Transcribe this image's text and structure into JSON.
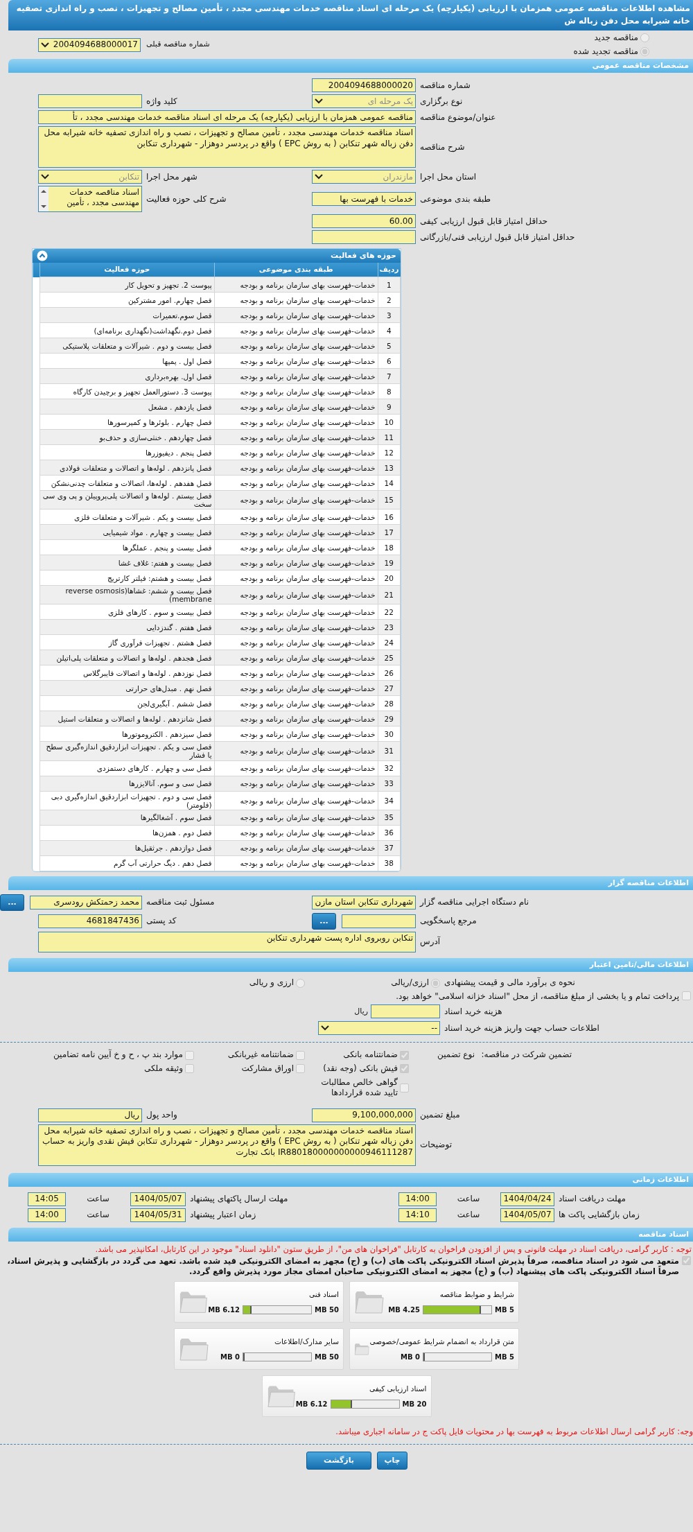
{
  "window": {
    "title": "مشاهده اطلاعات مناقصه عمومی همزمان با ارزیابی (یکپارچه) یک مرحله ای اسناد مناقصه خدمات مهندسی مجدد ، تأمین مصالح و تجهیزات ، نصب و راه اندازی تصفیه خانه شیرابه محل دفن زباله ش"
  },
  "tender_status": [
    {
      "label": "مناقصه جدید",
      "selected": false
    },
    {
      "label": "مناقصه تجدید شده",
      "selected": true
    }
  ],
  "previous_tender": {
    "label": "شماره مناقصه قبلی",
    "value": "2004094688000017"
  },
  "general": {
    "title": "مشخصات مناقصه عمومی",
    "rows": [
      [
        {
          "kind": "text",
          "label": "شماره مناقصه",
          "value": "2004094688000020"
        }
      ],
      [
        {
          "kind": "select",
          "label": "نوع برگزاری",
          "value": "یک مرحله ای",
          "disabled": true
        },
        {
          "kind": "text",
          "label": "کلید واژه"
        }
      ],
      [
        {
          "kind": "wide",
          "label": "عنوان/موضوع مناقصه",
          "value": "مناقصه عمومی همزمان با ارزیابی (یکپارچه) یک مرحله ای اسناد مناقصه خدمات مهندسی مجدد ، تأ"
        }
      ],
      [
        {
          "kind": "textarea",
          "label": "شرح مناقصه",
          "value": "اسناد مناقصه خدمات مهندسی مجدد ، تأمین مصالح و تجهیزات ، نصب و راه اندازی تصفیه خانه شیرابه محل دفن زباله شهر تنکابن ( به روش  EPC ) واقع در پردسر دوهزار - شهرداری تنکابن"
        }
      ],
      [
        {
          "kind": "select",
          "label": "استان محل اجرا",
          "value": "مازندران",
          "disabled": true
        },
        {
          "kind": "select",
          "label": "شهر محل اجرا",
          "value": "تنکابن",
          "disabled": true
        }
      ],
      [
        {
          "kind": "text",
          "label": "طبقه بندی موضوعی",
          "value": "خدمات با فهرست بها"
        },
        {
          "kind": "list",
          "label": "شرح کلی حوزه فعالیت",
          "value": "اسناد مناقصه خدمات مهندسی مجدد ، تأمین"
        }
      ],
      [
        {
          "kind": "text",
          "label": "حداقل امتیاز قابل قبول ارزیابی کیفی",
          "value": "60.00"
        }
      ],
      [
        {
          "kind": "text",
          "label": "حداقل امتیاز قابل قبول ارزیابی فنی/بازرگانی"
        }
      ]
    ]
  },
  "activities": {
    "title": "حوزه های فعالیت",
    "columns": [
      "ردیف",
      "طبقه بندی موضوعی",
      "حوزه فعالیت"
    ],
    "rows": [
      {
        "number": "1",
        "category": "خدمات-فهرست بهای سازمان برنامه و بودجه",
        "activity": "پیوست 2. تجهیز و تحویل کار"
      },
      {
        "number": "2",
        "category": "خدمات-فهرست بهای سازمان برنامه و بودجه",
        "activity": "فصل چهارم. امور مشترکین"
      },
      {
        "number": "3",
        "category": "خدمات-فهرست بهای سازمان برنامه و بودجه",
        "activity": "فصل سوم.تعمیرات"
      },
      {
        "number": "4",
        "category": "خدمات-فهرست بهای سازمان برنامه و بودجه",
        "activity": "فصل دوم.نگهداشت(نگهداری برنامه‌ای)"
      },
      {
        "number": "5",
        "category": "خدمات-فهرست بهای سازمان برنامه و بودجه",
        "activity": "فصل بیست و دوم . شیرآلات و متعلقات پلاستیکی"
      },
      {
        "number": "6",
        "category": "خدمات-فهرست بهای سازمان برنامه و بودجه",
        "activity": "فصل اول . پمپها"
      },
      {
        "number": "7",
        "category": "خدمات-فهرست بهای سازمان برنامه و بودجه",
        "activity": "فصل اول. بهره‌برداری"
      },
      {
        "number": "8",
        "category": "خدمات-فهرست بهای سازمان برنامه و بودجه",
        "activity": "پیوست 3. دستورالعمل تجهیز و برچیدن کارگاه"
      },
      {
        "number": "9",
        "category": "خدمات-فهرست بهای سازمان برنامه و بودجه",
        "activity": "فصل یازدهم . مشعل"
      },
      {
        "number": "10",
        "category": "خدمات-فهرست بهای سازمان برنامه و بودجه",
        "activity": "فصل چهارم . بلوئرها و کمپرسورها"
      },
      {
        "number": "11",
        "category": "خدمات-فهرست بهای سازمان برنامه و بودجه",
        "activity": "فصل چهاردهم . خنثی‌سازی و حذف‌بو"
      },
      {
        "number": "12",
        "category": "خدمات-فهرست بهای سازمان برنامه و بودجه",
        "activity": "فصل پنجم . دیفیوزرها"
      },
      {
        "number": "13",
        "category": "خدمات-فهرست بهای سازمان برنامه و بودجه",
        "activity": "فصل پانزدهم . لوله‌ها و اتصالات و متعلقات فولادی"
      },
      {
        "number": "14",
        "category": "خدمات-فهرست بهای سازمان برنامه و بودجه",
        "activity": "فصل هفدهم . لوله‌ها، اتصالات و متعلقات چدنی‌نشکن"
      },
      {
        "number": "15",
        "category": "خدمات-فهرست بهای سازمان برنامه و بودجه",
        "activity": "فصل بیستم . لوله‌ها و اتصالات پلی‌پروپیلن و پی وی سی سخت"
      },
      {
        "number": "16",
        "category": "خدمات-فهرست بهای سازمان برنامه و بودجه",
        "activity": "فصل بیست و یکم . شیرآلات و متعلقات فلزی"
      },
      {
        "number": "17",
        "category": "خدمات-فهرست بهای سازمان برنامه و بودجه",
        "activity": "فصل بیست و چهارم . مواد شیمیایی"
      },
      {
        "number": "18",
        "category": "خدمات-فهرست بهای سازمان برنامه و بودجه",
        "activity": "فصل بیست و پنجم . عملگرها"
      },
      {
        "number": "19",
        "category": "خدمات-فهرست بهای سازمان برنامه و بودجه",
        "activity": "فصل بیست و هفتم: غلاف غشا"
      },
      {
        "number": "20",
        "category": "خدمات-فهرست بهای سازمان برنامه و بودجه",
        "activity": "فصل بیست و هشتم: فیلتر کارتریج"
      },
      {
        "number": "21",
        "category": "خدمات-فهرست بهای سازمان برنامه و بودجه",
        "activity": "فصل بیست و ششم: غشاها(reverse osmosis membrane)"
      },
      {
        "number": "22",
        "category": "خدمات-فهرست بهای سازمان برنامه و بودجه",
        "activity": "فصل بیست و سوم . کارهای فلزی"
      },
      {
        "number": "23",
        "category": "خدمات-فهرست بهای سازمان برنامه و بودجه",
        "activity": "فصل هفتم . گندزدایی"
      },
      {
        "number": "24",
        "category": "خدمات-فهرست بهای سازمان برنامه و بودجه",
        "activity": "فصل هشتم . تجهیزات فرآوری گاز"
      },
      {
        "number": "25",
        "category": "خدمات-فهرست بهای سازمان برنامه و بودجه",
        "activity": "فصل هجدهم . لوله‌ها و اتصالات و متعلقات  پلی‌اتیلن"
      },
      {
        "number": "26",
        "category": "خدمات-فهرست بهای سازمان برنامه و بودجه",
        "activity": "فصل نوزدهم . لوله‌ها و اتصالات فایبرگلاس"
      },
      {
        "number": "27",
        "category": "خدمات-فهرست بهای سازمان برنامه و بودجه",
        "activity": "فصل نهم . مبدل‌های حرارتی"
      },
      {
        "number": "28",
        "category": "خدمات-فهرست بهای سازمان برنامه و بودجه",
        "activity": "فصل ششم . آبگیری‌لجن"
      },
      {
        "number": "29",
        "category": "خدمات-فهرست بهای سازمان برنامه و بودجه",
        "activity": "فصل شانزدهم . لوله‌ها و اتصالات و متعلقات استیل"
      },
      {
        "number": "30",
        "category": "خدمات-فهرست بهای سازمان برنامه و بودجه",
        "activity": "فصل سیزدهم . الکتروموتورها"
      },
      {
        "number": "31",
        "category": "خدمات-فهرست بهای سازمان برنامه و بودجه",
        "activity": "فصل سی و یکم . تجهیزات ابزاردقیق اندازه‌گیری سطح یا فشار"
      },
      {
        "number": "32",
        "category": "خدمات-فهرست بهای سازمان برنامه و بودجه",
        "activity": "فصل سی و چهارم . کارهای دستمزدی"
      },
      {
        "number": "33",
        "category": "خدمات-فهرست بهای سازمان برنامه و بودجه",
        "activity": "فصل سی و سوم. آنالایزرها"
      },
      {
        "number": "34",
        "category": "خدمات-فهرست بهای سازمان برنامه و بودجه",
        "activity": "فصل سی و دوم . تجهیزات ابزاردقیق اندازه‌گیری دبی (فلومتر)"
      },
      {
        "number": "35",
        "category": "خدمات-فهرست بهای سازمان برنامه و بودجه",
        "activity": "فصل سوم . آشغالگیرها"
      },
      {
        "number": "36",
        "category": "خدمات-فهرست بهای سازمان برنامه و بودجه",
        "activity": "فصل دوم . همزن‌ها"
      },
      {
        "number": "37",
        "category": "خدمات-فهرست بهای سازمان برنامه و بودجه",
        "activity": "فصل دوازدهم . جرثقیل‌ها"
      },
      {
        "number": "38",
        "category": "خدمات-فهرست بهای سازمان برنامه و بودجه",
        "activity": "فصل دهم . دیگ حرارتی آب گرم"
      }
    ]
  },
  "organizer": {
    "title": "اطلاعات مناقصه گزار",
    "rows": [
      [
        {
          "kind": "text",
          "label": "نام دستگاه اجرایی مناقصه گزار",
          "value": "شهرداری تنکابن استان مازن"
        },
        {
          "kind": "text",
          "label": "مسئول ثبت مناقصه",
          "value": "محمد  زحمتکش رودسری",
          "button": "..."
        }
      ],
      [
        {
          "kind": "text",
          "label": "مرجع پاسخگویی",
          "button": "..."
        },
        {
          "kind": "text",
          "label": "کد پستی",
          "value": "4681847436"
        }
      ],
      [
        {
          "kind": "textarea",
          "label": "آدرس",
          "value": "تنکابن روبروی اداره پست شهرداری تنکابن"
        }
      ]
    ]
  },
  "finance": {
    "title": "اطلاعات مالی/تامین اعتبار",
    "estimate": {
      "label": "نحوه ی برآورد مالی و قیمت پیشنهادی",
      "options": [
        {
          "label": "ارزی/ریالی",
          "selected": true
        },
        {
          "label": "ارزی و ریالی",
          "selected": false
        }
      ]
    },
    "treasury": {
      "label": "پرداخت تمام و یا بخشی از مبلغ مناقصه، از محل \"اسناد خزانه اسلامی\" خواهد بود.",
      "checked": false
    },
    "document_fee": {
      "label": "هزینه خرید اسناد",
      "unit": "ریال"
    },
    "fee_account": {
      "label": "اطلاعات حساب جهت واریز هزینه خرید اسناد",
      "value": "--"
    },
    "guarantee": {
      "label": "تضمین شرکت در مناقصه:",
      "type_label": "نوع تضمین",
      "options": [
        {
          "label": "ضمانتنامه بانکی",
          "checked": true
        },
        {
          "label": "ضمانتنامه غیربانکی",
          "checked": false
        },
        {
          "label": "موارد بند پ ، ح و خ آیین نامه تضامین",
          "checked": false
        },
        {
          "label": "فیش بانکی (وجه نقد)",
          "checked": true
        },
        {
          "label": "اوراق مشارکت",
          "checked": false
        },
        {
          "label": "وثیقه ملکی",
          "checked": false
        },
        {
          "label": "گواهی خالص مطالبات تایید شده قراردادها",
          "checked": false
        }
      ]
    },
    "rows": [
      [
        {
          "kind": "text",
          "label": "مبلغ تضمین",
          "value": "9,100,000,000"
        },
        {
          "kind": "text",
          "label": "واحد پول",
          "value": "ریال"
        }
      ],
      [
        {
          "kind": "textarea",
          "label": "توضیحات",
          "value": "اسناد مناقصه خدمات مهندسی مجدد ، تأمین مصالح و تجهیزات ، نصب و راه اندازی تصفیه خانه شیرابه محل دفن زباله شهر تنکابن ( به روش  EPC ) واقع در پردسر دوهزار - شهرداری تنکابن  فیش نقدی واریز به حساب IR880180000000000946111287  بانک تجارت"
        }
      ]
    ]
  },
  "schedule": {
    "title": "اطلاعات زمانی",
    "items": [
      {
        "label": "مهلت دریافت اسناد",
        "date": "1404/04/24",
        "time_label": "ساعت",
        "time": "14:00"
      },
      {
        "label": "مهلت ارسال پاکتهای پیشنهاد",
        "date": "1404/05/07",
        "time_label": "ساعت",
        "time": "14:05"
      },
      {
        "label": "زمان بازگشایی پاکت ها",
        "date": "1404/05/07",
        "time_label": "ساعت",
        "time": "14:10"
      },
      {
        "label": "زمان اعتبار پیشنهاد",
        "date": "1404/05/31",
        "time_label": "ساعت",
        "time": "14:00"
      }
    ]
  },
  "documents": {
    "title": "اسناد مناقصه",
    "notice": "توجه : کاربر گرامی، دریافت اسناد در مهلت قانونی و پس از افزودن فراخوان به کارتابل \"فراخوان های من\"، از طریق ستون \"دانلود اسناد\" موجود در این کارتابل، امکانپذیر می باشد.",
    "commitment": {
      "checked": true,
      "label": "متعهد می شود در اسناد مناقصه، صرفاً پذیرش اسناد الکترونیکی پاکت های (ب) و (ج) مجهز به امضای الکترونیکی قید شده باشد. تعهد می گردد در بازگشایی و پذیرش اسناد، صرفاً اسناد الکترونیکی پاکت های پیشنهاد (ب) و (ج) مجهز به امضای الکترونیکی صاحبان امضای مجاز مورد پذیرش واقع گردد."
    },
    "files": [
      {
        "title": "شرایط و ضوابط مناقصه",
        "used": "4.25 MB",
        "max": "5 MB",
        "level": 0.85
      },
      {
        "title": "اسناد فنی",
        "used": "6.12 MB",
        "max": "50 MB",
        "level": 0.12
      },
      {
        "title": "متن قرارداد به انضمام شرایط عمومی/خصوصی",
        "used": "0 MB",
        "max": "5 MB",
        "level": 0
      },
      {
        "title": "سایر مدارک/اطلاعات",
        "used": "0 MB",
        "max": "50 MB",
        "level": 0
      },
      {
        "title": "اسناد ارزیابی کیفی",
        "used": "6.12 MB",
        "max": "20 MB",
        "level": 0.31
      }
    ],
    "footer_notice": "وجه: کاربر گرامی ارسال اطلاعات مربوط به فهرست بها در محتویات فایل پاکت ج در سامانه اجباری میباشد."
  },
  "buttons": [
    {
      "label": "چاپ"
    },
    {
      "label": "بازگشت"
    }
  ]
}
